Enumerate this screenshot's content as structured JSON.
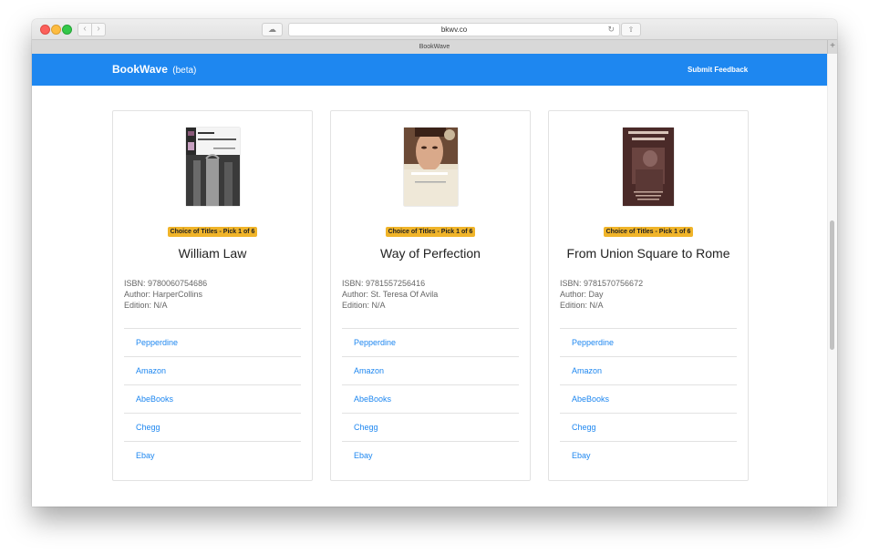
{
  "browser": {
    "url": "bkwv.co",
    "tab_title": "BookWave",
    "new_tab_icon": "plus-icon",
    "back_icon": "chevron-left-icon",
    "forward_icon": "chevron-right-icon"
  },
  "header": {
    "brand": "BookWave",
    "brand_suffix": "(beta)",
    "feedback_label": "Submit Feedback",
    "bg_color": "#1e87f0"
  },
  "books": [
    {
      "badge": "Choice of Titles - Pick 1 of 6",
      "title": "William Law",
      "isbn": "ISBN: 9780060754686",
      "author": "Author: HarperCollins",
      "edition": "Edition: N/A",
      "links": [
        "Pepperdine",
        "Amazon",
        "AbeBooks",
        "Chegg",
        "Ebay"
      ]
    },
    {
      "badge": "Choice of Titles - Pick 1 of 6",
      "title": "Way of Perfection",
      "isbn": "ISBN: 9781557256416",
      "author": "Author: St. Teresa Of Avila",
      "edition": "Edition: N/A",
      "links": [
        "Pepperdine",
        "Amazon",
        "AbeBooks",
        "Chegg",
        "Ebay"
      ]
    },
    {
      "badge": "Choice of Titles - Pick 1 of 6",
      "title": "From Union Square to Rome",
      "isbn": "ISBN: 9781570756672",
      "author": "Author: Day",
      "edition": "Edition: N/A",
      "links": [
        "Pepperdine",
        "Amazon",
        "AbeBooks",
        "Chegg",
        "Ebay"
      ]
    }
  ],
  "colors": {
    "accent": "#1e87f0",
    "badge": "#f0b429"
  }
}
